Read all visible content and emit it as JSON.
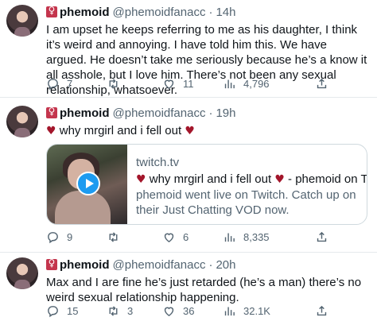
{
  "tweets": [
    {
      "name": "phemoid",
      "handle": "@phemoidfanacc",
      "dot": "·",
      "time": "14h",
      "text": "I am upset he keeps referring to me as his daughter, I think it’s weird and annoying. I have told him this. We have argued. He doesn’t take me seriously because he’s a know it all asshole, but I love him. There’s not been any sexual relationship, whatsoever.",
      "replies": "7",
      "retweets": "",
      "likes": "11",
      "views": "4,796"
    },
    {
      "name": "phemoid",
      "handle": "@phemoidfanacc",
      "dot": "·",
      "time": "19h",
      "text": "why mrgirl and i fell out",
      "card": {
        "domain": "twitch.tv",
        "title": "why mrgirl and i fell out",
        "title_suffix": "- phemoid on Twitch",
        "description": "phemoid went live on Twitch. Catch up on their Just Chatting VOD now."
      },
      "replies": "9",
      "retweets": "",
      "likes": "6",
      "views": "8,335"
    },
    {
      "name": "phemoid",
      "handle": "@phemoidfanacc",
      "dot": "·",
      "time": "20h",
      "text": "Max and I are fine he’s just retarded (he’s a man) there’s no weird sexual relationship happening.",
      "replies": "15",
      "retweets": "3",
      "likes": "36",
      "views": "32.1K"
    }
  ],
  "icons": {
    "heart": "♥",
    "badge": "female-sign-icon",
    "reply": "reply-icon",
    "retweet": "retweet-icon",
    "like": "like-icon",
    "views": "views-icon",
    "share": "share-icon"
  },
  "colors": {
    "secondary_text": "#536471",
    "heart": "#a3162b",
    "badge": "#c4354d",
    "play": "#1d9bf0"
  }
}
